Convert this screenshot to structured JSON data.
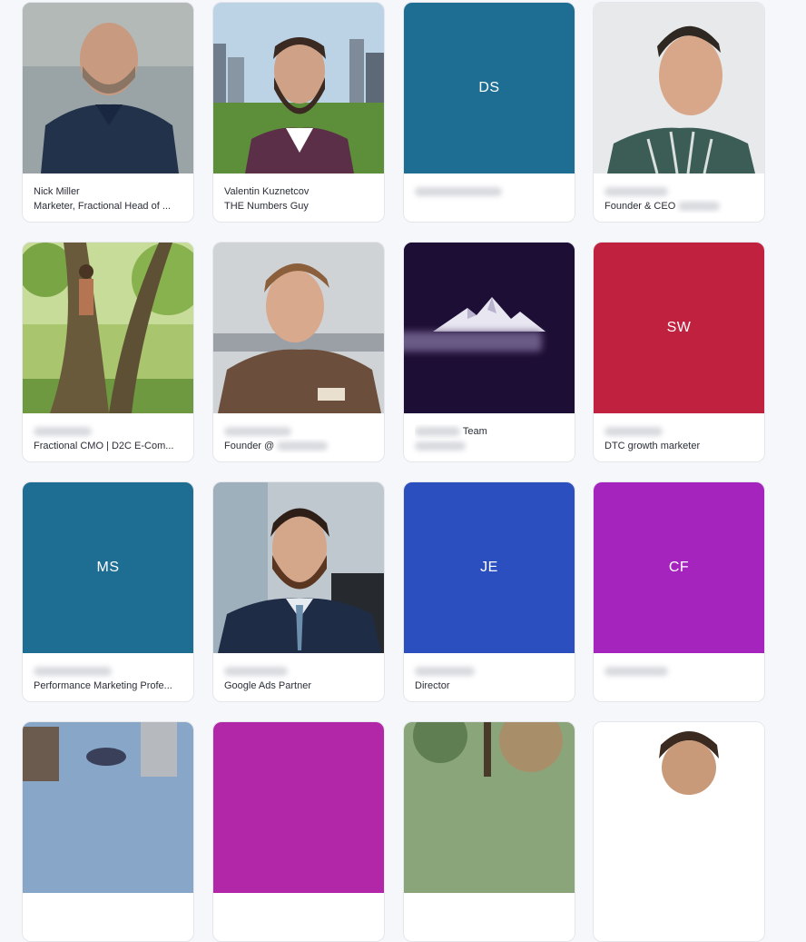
{
  "colors": {
    "teal": "#1e6e94",
    "blue": "#2b4fbf",
    "crimson": "#c0213e",
    "magenta": "#a524be",
    "navy_purple": "#1d0e35",
    "card_bg": "#ffffff",
    "page_bg": "#f6f7fa"
  },
  "cards": [
    {
      "type": "photo",
      "icon": "person-photo",
      "line1": "Nick Miller",
      "line2": "Marketer, Fractional Head of ..."
    },
    {
      "type": "photo",
      "icon": "person-photo",
      "line1": "Valentin Kuznetcov",
      "line2": "THE Numbers Guy"
    },
    {
      "type": "initials",
      "initials": "DS",
      "color": "#1e6e94",
      "line1": "",
      "line2": ""
    },
    {
      "type": "photo",
      "icon": "person-photo",
      "line1": "",
      "line2": "Founder & CEO"
    },
    {
      "type": "photo",
      "icon": "tree-climber-photo",
      "line1": "",
      "line2": "Fractional CMO | D2C E-Com..."
    },
    {
      "type": "photo",
      "icon": "person-photo",
      "line1": "",
      "line2": "Founder @"
    },
    {
      "type": "logo",
      "icon": "mountain-logo-icon",
      "line1": "Team",
      "line2": ""
    },
    {
      "type": "initials",
      "initials": "SW",
      "color": "#c0213e",
      "line1": "",
      "line2": "DTC growth marketer"
    },
    {
      "type": "initials",
      "initials": "MS",
      "color": "#1e6e94",
      "line1": "",
      "line2": "Performance Marketing Profe..."
    },
    {
      "type": "photo",
      "icon": "person-photo",
      "line1": "",
      "line2": "Google Ads Partner"
    },
    {
      "type": "initials",
      "initials": "JE",
      "color": "#2b4fbf",
      "line1": "",
      "line2": "Director"
    },
    {
      "type": "initials",
      "initials": "CF",
      "color": "#a524be",
      "line1": "",
      "line2": ""
    }
  ]
}
